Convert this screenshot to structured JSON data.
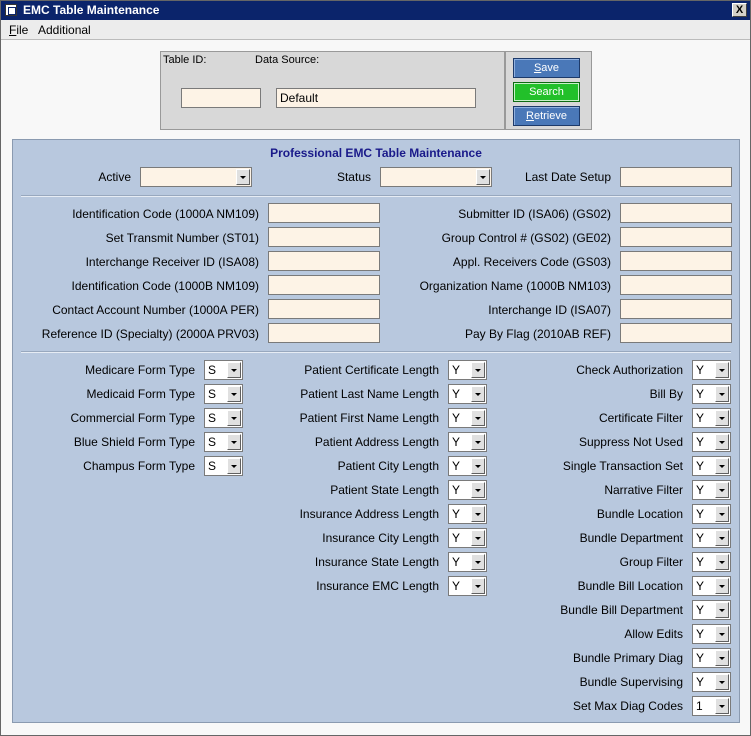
{
  "window": {
    "title": "EMC Table Maintenance",
    "close_label": "X"
  },
  "menu": {
    "file_ul": "F",
    "file_rest": "ile",
    "additional": "Additional"
  },
  "top": {
    "table_id_label": "Table ID:",
    "data_source_label": "Data Source:",
    "table_id_value": "",
    "data_source_value": "Default"
  },
  "buttons": {
    "save_ul": "S",
    "save_rest": "ave",
    "search": "Search",
    "retrieve_ul": "R",
    "retrieve_rest": "etrieve"
  },
  "main": {
    "title": "Professional EMC Table Maintenance",
    "active_label": "Active",
    "status_label": "Status",
    "last_date_setup_label": "Last Date Setup",
    "active_value": "",
    "status_value": "",
    "last_date_setup_value": ""
  },
  "left_fields": [
    {
      "label": "Identification Code (1000A NM109)",
      "value": ""
    },
    {
      "label": "Set Transmit Number (ST01)",
      "value": ""
    },
    {
      "label": "Interchange Receiver ID (ISA08)",
      "value": ""
    },
    {
      "label": "Identification Code (1000B NM109)",
      "value": ""
    },
    {
      "label": "Contact Account Number (1000A PER)",
      "value": ""
    },
    {
      "label": "Reference ID (Specialty) (2000A PRV03)",
      "value": ""
    }
  ],
  "right_fields": [
    {
      "label": "Submitter ID (ISA06) (GS02)",
      "value": ""
    },
    {
      "label": "Group Control # (GS02) (GE02)",
      "value": ""
    },
    {
      "label": "Appl. Receivers Code (GS03)",
      "value": ""
    },
    {
      "label": "Organization Name (1000B NM103)",
      "value": ""
    },
    {
      "label": "Interchange ID (ISA07)",
      "value": ""
    },
    {
      "label": "Pay By Flag (2010AB REF)",
      "value": ""
    }
  ],
  "form_types": [
    {
      "label": "Medicare Form Type",
      "value": "S"
    },
    {
      "label": "Medicaid Form Type",
      "value": "S"
    },
    {
      "label": "Commercial Form Type",
      "value": "S"
    },
    {
      "label": "Blue Shield Form Type",
      "value": "S"
    },
    {
      "label": "Champus Form Type",
      "value": "S"
    }
  ],
  "lengths": [
    {
      "label": "Patient Certificate Length",
      "value": "Y"
    },
    {
      "label": "Patient Last Name Length",
      "value": "Y"
    },
    {
      "label": "Patient First Name Length",
      "value": "Y"
    },
    {
      "label": "Patient Address Length",
      "value": "Y"
    },
    {
      "label": "Patient City Length",
      "value": "Y"
    },
    {
      "label": "Patient State Length",
      "value": "Y"
    },
    {
      "label": "Insurance Address Length",
      "value": "Y"
    },
    {
      "label": "Insurance City Length",
      "value": "Y"
    },
    {
      "label": "Insurance State Length",
      "value": "Y"
    },
    {
      "label": "Insurance EMC Length",
      "value": "Y"
    }
  ],
  "flags": [
    {
      "label": "Check Authorization",
      "value": "Y"
    },
    {
      "label": "Bill By",
      "value": "Y"
    },
    {
      "label": "Certificate Filter",
      "value": "Y"
    },
    {
      "label": "Suppress Not Used",
      "value": "Y"
    },
    {
      "label": "Single Transaction Set",
      "value": "Y"
    },
    {
      "label": "Narrative Filter",
      "value": "Y"
    },
    {
      "label": "Bundle Location",
      "value": "Y"
    },
    {
      "label": "Bundle Department",
      "value": "Y"
    },
    {
      "label": "Group Filter",
      "value": "Y"
    },
    {
      "label": "Bundle Bill Location",
      "value": "Y"
    },
    {
      "label": "Bundle Bill Department",
      "value": "Y"
    },
    {
      "label": "Allow Edits",
      "value": "Y"
    },
    {
      "label": "Bundle Primary Diag",
      "value": "Y"
    },
    {
      "label": "Bundle Supervising",
      "value": "Y"
    },
    {
      "label": "Set Max Diag Codes",
      "value": "1"
    }
  ]
}
